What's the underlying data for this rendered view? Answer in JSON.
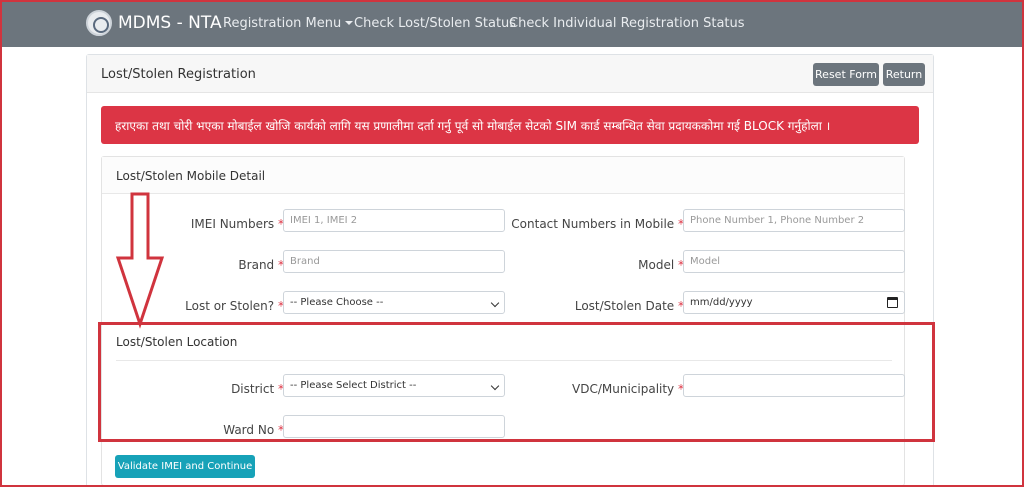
{
  "navbar": {
    "brand": "MDMS - NTA",
    "menu_registration": "Registration Menu",
    "menu_lost_status": "Check Lost/Stolen Status",
    "menu_individual_status": "Check Individual Registration Status"
  },
  "header": {
    "title": "Lost/Stolen Registration",
    "reset_label": "Reset Form",
    "return_label": "Return"
  },
  "alert": {
    "text": "हराएका तथा चोरी भएका मोबाईल खोजि कार्यको लागि यस प्रणालीमा दर्ता गर्नु पूर्व सो मोबाईल सेटको SIM कार्ड सम्बन्धित सेवा प्रदायककोमा गई BLOCK गर्नुहोला ।"
  },
  "detail": {
    "title": "Lost/Stolen Mobile Detail",
    "imei_label": "IMEI Numbers",
    "imei_placeholder": "IMEI 1, IMEI 2",
    "contact_label": "Contact Numbers in Mobile",
    "contact_placeholder": "Phone Number 1, Phone Number 2",
    "brand_label": "Brand",
    "brand_placeholder": "Brand",
    "model_label": "Model",
    "model_placeholder": "Model",
    "lost_or_stolen_label": "Lost or Stolen?",
    "lost_or_stolen_value": "-- Please Choose --",
    "date_label": "Lost/Stolen Date",
    "date_value": "mm/dd/yyyy"
  },
  "location": {
    "title": "Lost/Stolen Location",
    "district_label": "District",
    "district_value": "-- Please Select District --",
    "vdc_label": "VDC/Municipality",
    "ward_label": "Ward No"
  },
  "actions": {
    "validate_label": "Validate IMEI and Continue"
  },
  "required_mark": "*",
  "colors": {
    "navbar": "#6c757d",
    "alert": "#dc3545",
    "primary_action": "#17a2b8",
    "annotation": "#d0343e"
  }
}
